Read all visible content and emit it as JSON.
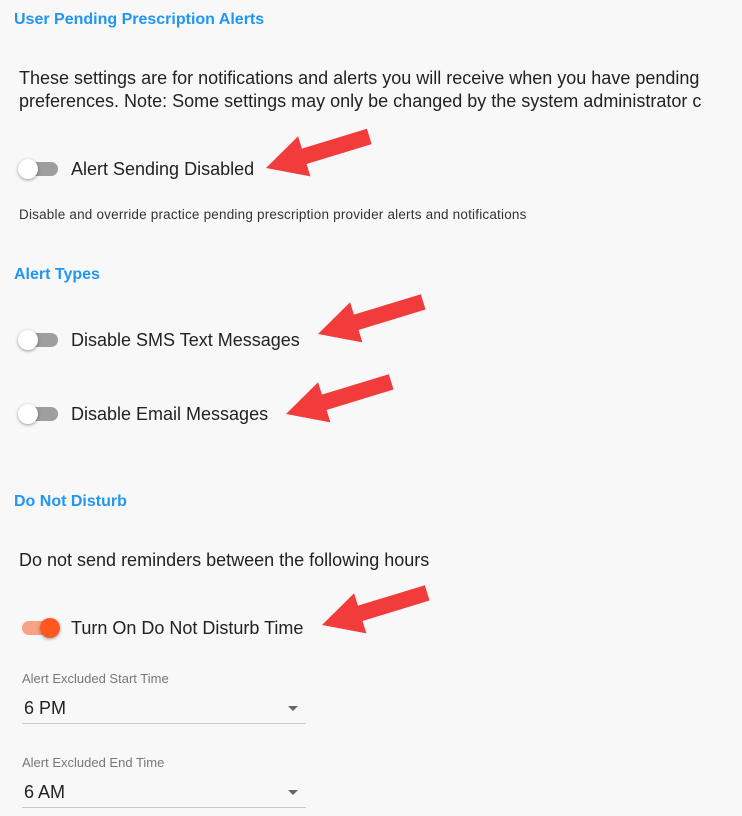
{
  "colors": {
    "accent": "#2196f3",
    "toggle_on": "#ff5722",
    "toggle_off": "#9e9e9e",
    "annotation_arrow": "#f23b3b"
  },
  "header": {
    "title": "User Pending Prescription Alerts"
  },
  "intro": {
    "line1": "These settings are for notifications and alerts you will receive when you have pending",
    "line2": "preferences. Note: Some settings may only be changed by the system administrator c"
  },
  "alert_sending": {
    "label": "Alert Sending Disabled",
    "checked": false,
    "helper": "Disable and override practice pending prescription provider alerts and notifications"
  },
  "alert_types": {
    "title": "Alert Types",
    "sms_label": "Disable SMS Text Messages",
    "sms_checked": false,
    "email_label": "Disable Email Messages",
    "email_checked": false
  },
  "dnd": {
    "title": "Do Not Disturb",
    "description": "Do not send reminders between the following hours",
    "toggle_label": "Turn On Do Not Disturb Time",
    "toggle_checked": true,
    "start": {
      "label": "Alert Excluded Start Time",
      "value": "6 PM"
    },
    "end": {
      "label": "Alert Excluded End Time",
      "value": "6 AM"
    }
  },
  "annotations": {
    "arrow_icon": "red-arrow-icon"
  }
}
